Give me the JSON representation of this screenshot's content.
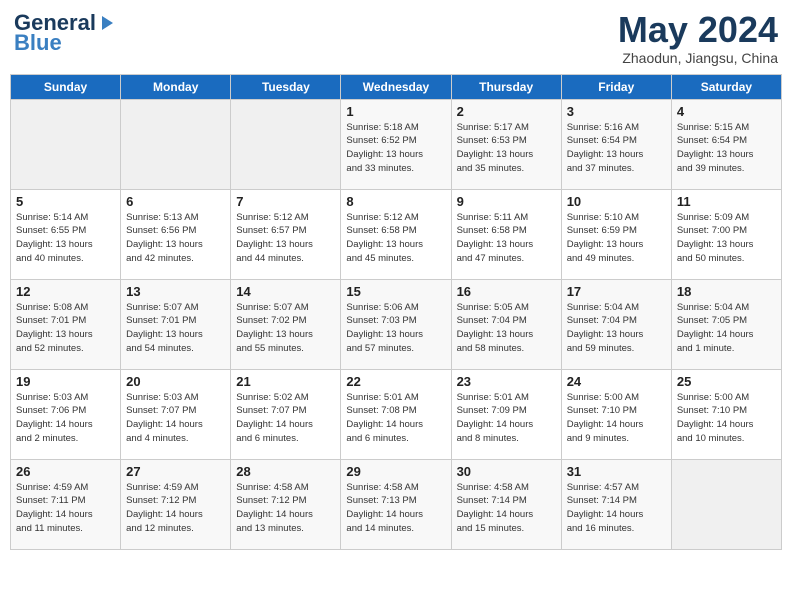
{
  "header": {
    "logo_general": "General",
    "logo_blue": "Blue",
    "title": "May 2024",
    "subtitle": "Zhaodun, Jiangsu, China"
  },
  "days_of_week": [
    "Sunday",
    "Monday",
    "Tuesday",
    "Wednesday",
    "Thursday",
    "Friday",
    "Saturday"
  ],
  "weeks": [
    [
      {
        "day": "",
        "info": ""
      },
      {
        "day": "",
        "info": ""
      },
      {
        "day": "",
        "info": ""
      },
      {
        "day": "1",
        "info": "Sunrise: 5:18 AM\nSunset: 6:52 PM\nDaylight: 13 hours\nand 33 minutes."
      },
      {
        "day": "2",
        "info": "Sunrise: 5:17 AM\nSunset: 6:53 PM\nDaylight: 13 hours\nand 35 minutes."
      },
      {
        "day": "3",
        "info": "Sunrise: 5:16 AM\nSunset: 6:54 PM\nDaylight: 13 hours\nand 37 minutes."
      },
      {
        "day": "4",
        "info": "Sunrise: 5:15 AM\nSunset: 6:54 PM\nDaylight: 13 hours\nand 39 minutes."
      }
    ],
    [
      {
        "day": "5",
        "info": "Sunrise: 5:14 AM\nSunset: 6:55 PM\nDaylight: 13 hours\nand 40 minutes."
      },
      {
        "day": "6",
        "info": "Sunrise: 5:13 AM\nSunset: 6:56 PM\nDaylight: 13 hours\nand 42 minutes."
      },
      {
        "day": "7",
        "info": "Sunrise: 5:12 AM\nSunset: 6:57 PM\nDaylight: 13 hours\nand 44 minutes."
      },
      {
        "day": "8",
        "info": "Sunrise: 5:12 AM\nSunset: 6:58 PM\nDaylight: 13 hours\nand 45 minutes."
      },
      {
        "day": "9",
        "info": "Sunrise: 5:11 AM\nSunset: 6:58 PM\nDaylight: 13 hours\nand 47 minutes."
      },
      {
        "day": "10",
        "info": "Sunrise: 5:10 AM\nSunset: 6:59 PM\nDaylight: 13 hours\nand 49 minutes."
      },
      {
        "day": "11",
        "info": "Sunrise: 5:09 AM\nSunset: 7:00 PM\nDaylight: 13 hours\nand 50 minutes."
      }
    ],
    [
      {
        "day": "12",
        "info": "Sunrise: 5:08 AM\nSunset: 7:01 PM\nDaylight: 13 hours\nand 52 minutes."
      },
      {
        "day": "13",
        "info": "Sunrise: 5:07 AM\nSunset: 7:01 PM\nDaylight: 13 hours\nand 54 minutes."
      },
      {
        "day": "14",
        "info": "Sunrise: 5:07 AM\nSunset: 7:02 PM\nDaylight: 13 hours\nand 55 minutes."
      },
      {
        "day": "15",
        "info": "Sunrise: 5:06 AM\nSunset: 7:03 PM\nDaylight: 13 hours\nand 57 minutes."
      },
      {
        "day": "16",
        "info": "Sunrise: 5:05 AM\nSunset: 7:04 PM\nDaylight: 13 hours\nand 58 minutes."
      },
      {
        "day": "17",
        "info": "Sunrise: 5:04 AM\nSunset: 7:04 PM\nDaylight: 13 hours\nand 59 minutes."
      },
      {
        "day": "18",
        "info": "Sunrise: 5:04 AM\nSunset: 7:05 PM\nDaylight: 14 hours\nand 1 minute."
      }
    ],
    [
      {
        "day": "19",
        "info": "Sunrise: 5:03 AM\nSunset: 7:06 PM\nDaylight: 14 hours\nand 2 minutes."
      },
      {
        "day": "20",
        "info": "Sunrise: 5:03 AM\nSunset: 7:07 PM\nDaylight: 14 hours\nand 4 minutes."
      },
      {
        "day": "21",
        "info": "Sunrise: 5:02 AM\nSunset: 7:07 PM\nDaylight: 14 hours\nand 6 minutes."
      },
      {
        "day": "22",
        "info": "Sunrise: 5:01 AM\nSunset: 7:08 PM\nDaylight: 14 hours\nand 6 minutes."
      },
      {
        "day": "23",
        "info": "Sunrise: 5:01 AM\nSunset: 7:09 PM\nDaylight: 14 hours\nand 8 minutes."
      },
      {
        "day": "24",
        "info": "Sunrise: 5:00 AM\nSunset: 7:10 PM\nDaylight: 14 hours\nand 9 minutes."
      },
      {
        "day": "25",
        "info": "Sunrise: 5:00 AM\nSunset: 7:10 PM\nDaylight: 14 hours\nand 10 minutes."
      }
    ],
    [
      {
        "day": "26",
        "info": "Sunrise: 4:59 AM\nSunset: 7:11 PM\nDaylight: 14 hours\nand 11 minutes."
      },
      {
        "day": "27",
        "info": "Sunrise: 4:59 AM\nSunset: 7:12 PM\nDaylight: 14 hours\nand 12 minutes."
      },
      {
        "day": "28",
        "info": "Sunrise: 4:58 AM\nSunset: 7:12 PM\nDaylight: 14 hours\nand 13 minutes."
      },
      {
        "day": "29",
        "info": "Sunrise: 4:58 AM\nSunset: 7:13 PM\nDaylight: 14 hours\nand 14 minutes."
      },
      {
        "day": "30",
        "info": "Sunrise: 4:58 AM\nSunset: 7:14 PM\nDaylight: 14 hours\nand 15 minutes."
      },
      {
        "day": "31",
        "info": "Sunrise: 4:57 AM\nSunset: 7:14 PM\nDaylight: 14 hours\nand 16 minutes."
      },
      {
        "day": "",
        "info": ""
      }
    ]
  ]
}
